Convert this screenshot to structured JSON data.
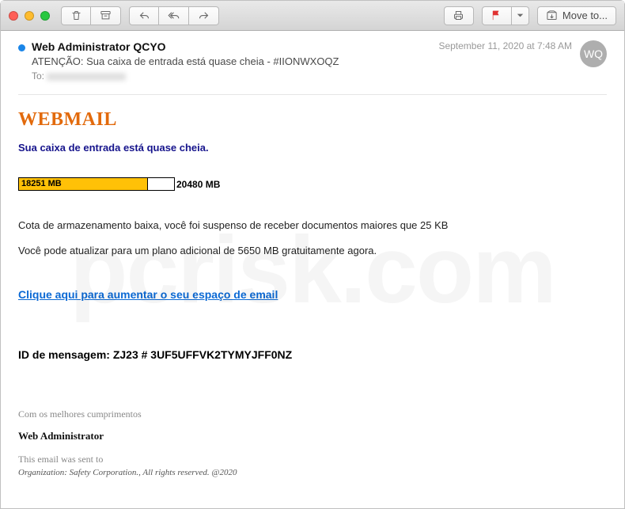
{
  "toolbar": {
    "move_to_label": "Move to..."
  },
  "header": {
    "sender": "Web Administrator QCYO",
    "subject": "ATENÇÃO: Sua caixa de entrada está quase cheia - #IIONWXOQZ",
    "to_label": "To:",
    "timestamp": "September 11, 2020 at 7:48 AM",
    "avatar_initials": "WQ"
  },
  "body": {
    "brand": "WEBMAIL",
    "warning": "Sua caixa de entrada está quase cheia.",
    "usage_current": "18251 MB",
    "usage_total": "20480 MB",
    "usage_percent": 83,
    "para1": "Cota de armazenamento baixa, você foi suspenso de receber documentos maiores que 25 KB",
    "para2": "Você pode atualizar para um plano adicional de 5650 MB gratuitamente agora.",
    "cta": "Clique aqui para aumentar o seu espaço de email",
    "message_id": "ID de mensagem: ZJ23 # 3UF5UFFVK2TYMYJFF0NZ",
    "closing": "Com os melhores cumprimentos",
    "signature": "Web Administrator",
    "footer1": "This email was sent to",
    "footer2": "Organization:  Safety Corporation., All rights reserved.  @2020"
  },
  "watermark": "pcrisk.com"
}
